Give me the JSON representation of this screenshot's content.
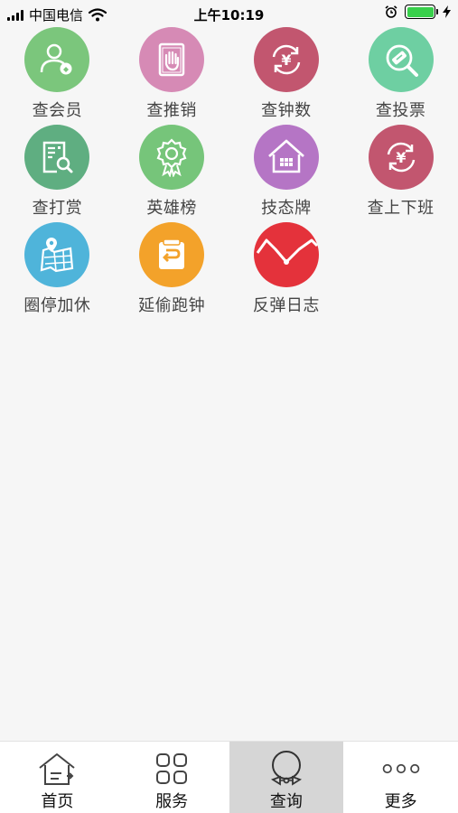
{
  "status_bar": {
    "carrier": "中国电信",
    "time": "上午10:19"
  },
  "tiles": [
    {
      "label": "查会员",
      "icon": "member-icon",
      "color": "#7bc67c"
    },
    {
      "label": "查推销",
      "icon": "hand-book-icon",
      "color": "#d68ab5"
    },
    {
      "label": "查钟数",
      "icon": "yen-cycle-icon",
      "color": "#c2566f"
    },
    {
      "label": "查投票",
      "icon": "ticket-search-icon",
      "color": "#6ecfa2"
    },
    {
      "label": "查打赏",
      "icon": "document-search-icon",
      "color": "#5fae81"
    },
    {
      "label": "英雄榜",
      "icon": "award-badge-icon",
      "color": "#76c57a"
    },
    {
      "label": "技态牌",
      "icon": "house-icon",
      "color": "#b575c5"
    },
    {
      "label": "查上下班",
      "icon": "yen-cycle-icon",
      "color": "#c2566f"
    },
    {
      "label": "圈停加休",
      "icon": "map-pin-icon",
      "color": "#4fb4da"
    },
    {
      "label": "延偷跑钟",
      "icon": "return-box-icon",
      "color": "#f3a22a"
    },
    {
      "label": "反弹日志",
      "icon": "trend-line-icon",
      "color": "#e4323b"
    }
  ],
  "tabbar": {
    "items": [
      {
        "label": "首页",
        "icon": "home-icon",
        "active": false
      },
      {
        "label": "服务",
        "icon": "service-grid-icon",
        "active": false
      },
      {
        "label": "查询",
        "icon": "query-bowtie-icon",
        "active": true
      },
      {
        "label": "更多",
        "icon": "more-dots-icon",
        "active": false
      }
    ]
  }
}
